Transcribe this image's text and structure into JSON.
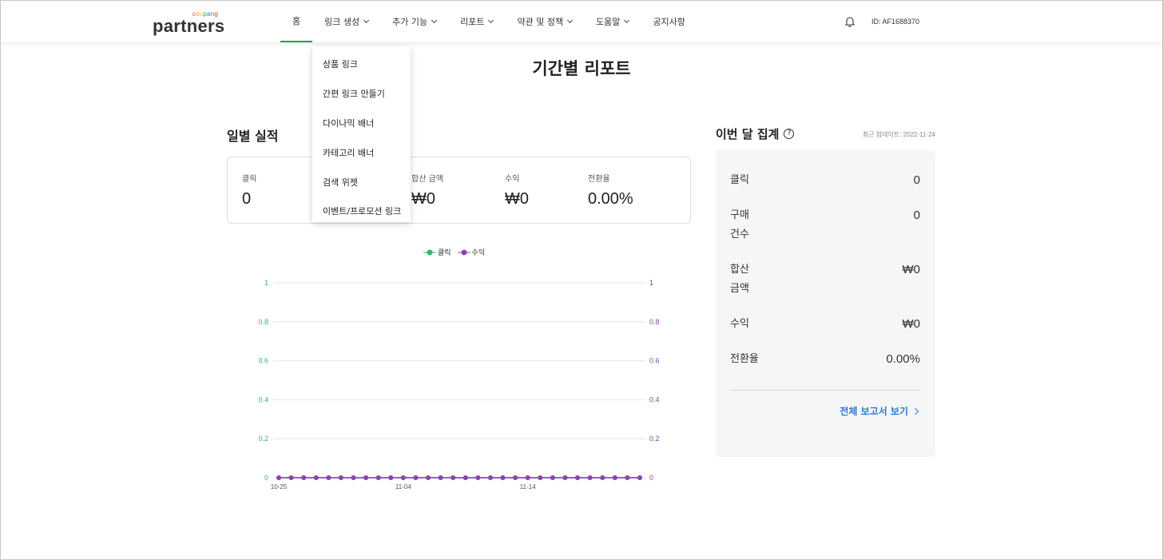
{
  "header": {
    "logo_sup": "coupang",
    "logo_main": "partners",
    "nav": [
      {
        "label": "홈",
        "has_chevron": false
      },
      {
        "label": "링크 생성",
        "has_chevron": true
      },
      {
        "label": "추가 기능",
        "has_chevron": true
      },
      {
        "label": "리포트",
        "has_chevron": true
      },
      {
        "label": "약관 및 정책",
        "has_chevron": true
      },
      {
        "label": "도움말",
        "has_chevron": true
      },
      {
        "label": "공지사항",
        "has_chevron": false
      }
    ],
    "active_nav": "링크 생성",
    "bell_icon": "bell-icon",
    "user_id": "ID: AF1688370"
  },
  "dropdown": {
    "items": [
      "상품 링크",
      "간편 링크 만들기",
      "다이나믹 배너",
      "카테고리 배너",
      "검색 위젯",
      "이벤트/프로모션 링크"
    ]
  },
  "page_title": "기간별 리포트",
  "daily": {
    "title": "일별 실적",
    "stats": [
      {
        "label": "클릭",
        "value": "0"
      },
      {
        "label": "합산 금액",
        "value": "₩0"
      },
      {
        "label": "수익",
        "value": "₩0"
      },
      {
        "label": "전환율",
        "value": "0.00%"
      }
    ]
  },
  "chart_data": {
    "type": "line",
    "x": [
      "10-25",
      "10-26",
      "10-27",
      "10-28",
      "10-29",
      "10-30",
      "10-31",
      "11-01",
      "11-02",
      "11-03",
      "11-04",
      "11-05",
      "11-06",
      "11-07",
      "11-08",
      "11-09",
      "11-10",
      "11-11",
      "11-12",
      "11-13",
      "11-14",
      "11-15",
      "11-16",
      "11-17",
      "11-18",
      "11-19",
      "11-20",
      "11-21",
      "11-22",
      "11-23"
    ],
    "x_tick_labels": [
      "10-25",
      "11-04",
      "11-14"
    ],
    "series": [
      {
        "name": "클릭",
        "color": "#3cb371",
        "values": [
          0,
          0,
          0,
          0,
          0,
          0,
          0,
          0,
          0,
          0,
          0,
          0,
          0,
          0,
          0,
          0,
          0,
          0,
          0,
          0,
          0,
          0,
          0,
          0,
          0,
          0,
          0,
          0,
          0,
          0
        ]
      },
      {
        "name": "수익",
        "color": "#8e44ad",
        "values": [
          0,
          0,
          0,
          0,
          0,
          0,
          0,
          0,
          0,
          0,
          0,
          0,
          0,
          0,
          0,
          0,
          0,
          0,
          0,
          0,
          0,
          0,
          0,
          0,
          0,
          0,
          0,
          0,
          0,
          0
        ]
      }
    ],
    "y_ticks": [
      "0",
      "0.2",
      "0.4",
      "0.6",
      "0.8",
      "1"
    ],
    "ylim": [
      0,
      1
    ],
    "legend_position": "top-center",
    "grid": true
  },
  "monthly": {
    "title": "이번 달 집계",
    "help_icon": "help-circle-icon",
    "update_text": "최근 업데이트: 2022-11-24",
    "rows": [
      {
        "label": "클릭",
        "value": "0"
      },
      {
        "label": "구매 건수",
        "value": "0"
      },
      {
        "label": "합산 금액",
        "value": "₩0"
      },
      {
        "label": "수익",
        "value": "₩0"
      },
      {
        "label": "전환율",
        "value": "0.00%"
      }
    ],
    "full_report_label": "전체 보고서 보기"
  },
  "colors": {
    "active_nav_underline": "#1aa34a",
    "link_blue": "#2a7ad8",
    "click_series": "#3cb371",
    "revenue_series": "#8e44ad"
  }
}
